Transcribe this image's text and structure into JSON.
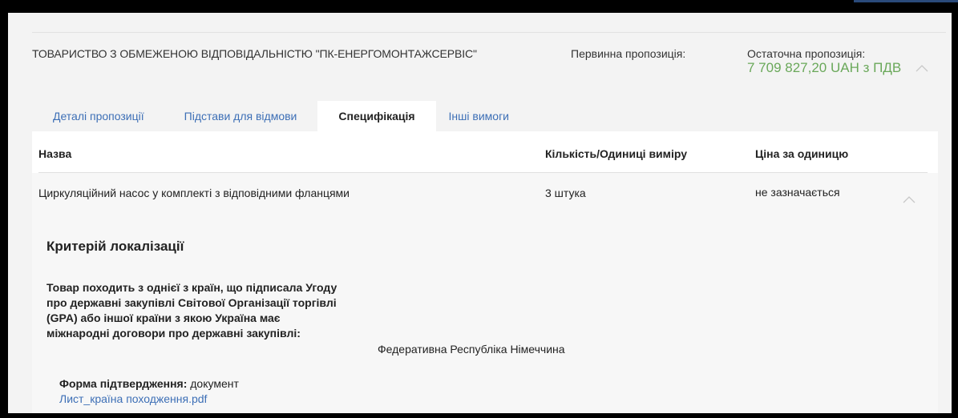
{
  "proposal": {
    "supplier_name": "ТОВАРИСТВО З ОБМЕЖЕНОЮ ВІДПОВІДАЛЬНІСТЮ \"ПК-ЕНЕРГОМОНТАЖСЕРВІС\"",
    "initial_label": "Первинна пропозиція:",
    "final_label": "Остаточна пропозиція:",
    "final_value": "7 709 827,20 UAH з ПДВ",
    "collapse_icon": "chevron-up-icon"
  },
  "tabs": [
    {
      "label": "Деталі пропозиції",
      "active": false
    },
    {
      "label": "Підстави для відмови",
      "active": false
    },
    {
      "label": "Специфікація",
      "active": true
    },
    {
      "label": "Інші вимоги",
      "active": false
    }
  ],
  "table": {
    "headers": [
      "Назва",
      "Кількість/Одиниці виміру",
      "Ціна за одиницю"
    ],
    "rows": [
      {
        "name": "Циркуляційний насос у комплекті з відповідними фланцями",
        "quantity": "3 штука",
        "price": "не зазначається"
      }
    ]
  },
  "criteria": {
    "title": "Критерій локалізації",
    "text": "Товар походить з однієї з країн, що підписала Угоду про державні закупівлі Світової Організації торгівлі (GPA) або іншої країни з якою Україна має міжнародні договори про державні закупівлі:",
    "country": "Федеративна Республіка Німеччина",
    "confirm_label": "Форма підтвердження:",
    "confirm_value": "документ",
    "document_link": "Лист_країна походження.pdf"
  },
  "colors": {
    "accent_link": "#3d6fb6",
    "price_green": "#6aa85a",
    "panel_bg": "#f3f3f3"
  }
}
